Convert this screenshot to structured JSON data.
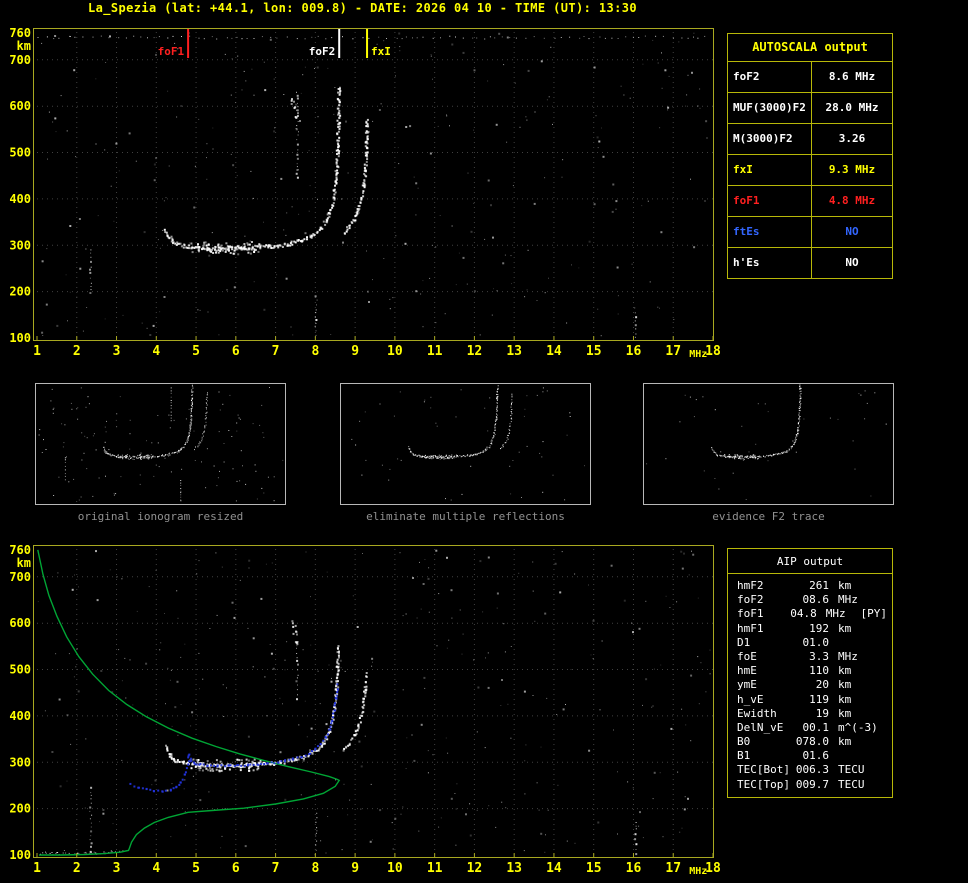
{
  "title": "La_Spezia (lat: +44.1, lon: 009.8) - DATE: 2026 04 10 - TIME (UT): 13:30",
  "colors": {
    "background": "#000000",
    "title": "#ffff00",
    "axis_label": "#ffff00",
    "plot_border": "#a8a820",
    "table_border": "#b8b808",
    "grid": "#404040",
    "trace": "#ffffff",
    "profile_green": "#00a535",
    "scaled_trace_blue": "#2233dd",
    "caption_gray": "#919191"
  },
  "autoscala_table": {
    "header": "AUTOSCALA output",
    "rows": [
      {
        "label": "foF2",
        "value": "8.6 MHz",
        "color": "#ffffff"
      },
      {
        "label": "MUF(3000)F2",
        "value": "28.0 MHz",
        "color": "#ffffff"
      },
      {
        "label": "M(3000)F2",
        "value": "3.26",
        "color": "#ffffff"
      },
      {
        "label": "fxI",
        "value": "9.3 MHz",
        "color": "#ffff00"
      },
      {
        "label": "foF1",
        "value": "4.8 MHz",
        "color": "#ff2020"
      },
      {
        "label": "ftEs",
        "value": "NO",
        "color": "#3366ff"
      },
      {
        "label": "h'Es",
        "value": "NO",
        "color": "#ffffff"
      }
    ]
  },
  "aip_table": {
    "header": "AIP output",
    "rows": [
      {
        "label": "hmF2",
        "value": "261",
        "unit": "km",
        "note": ""
      },
      {
        "label": "foF2",
        "value": "08.6",
        "unit": "MHz",
        "note": ""
      },
      {
        "label": "foF1",
        "value": "04.8",
        "unit": "MHz",
        "note": "[PY]"
      },
      {
        "label": "hmF1",
        "value": "192",
        "unit": "km",
        "note": ""
      },
      {
        "label": "D1",
        "value": "01.0",
        "unit": "",
        "note": ""
      },
      {
        "label": "foE",
        "value": "3.3",
        "unit": "MHz",
        "note": ""
      },
      {
        "label": "hmE",
        "value": "110",
        "unit": "km",
        "note": ""
      },
      {
        "label": "ymE",
        "value": "20",
        "unit": "km",
        "note": ""
      },
      {
        "label": "h_vE",
        "value": "119",
        "unit": "km",
        "note": ""
      },
      {
        "label": "Ewidth",
        "value": "19",
        "unit": "km",
        "note": ""
      },
      {
        "label": "DelN_vE",
        "value": "00.1",
        "unit": "m^(-3)",
        "note": ""
      },
      {
        "label": "B0",
        "value": "078.0",
        "unit": "km",
        "note": ""
      },
      {
        "label": "B1",
        "value": "01.6",
        "unit": "",
        "note": ""
      },
      {
        "label": "TEC[Bot]",
        "value": "006.3",
        "unit": "TECU",
        "note": ""
      },
      {
        "label": "TEC[Top]",
        "value": "009.7",
        "unit": "TECU",
        "note": ""
      }
    ]
  },
  "thumbnails": [
    {
      "caption": "original ionogram resized"
    },
    {
      "caption": "eliminate multiple reflections"
    },
    {
      "caption": "evidence F2 trace"
    }
  ],
  "chart_data": [
    {
      "type": "scatter",
      "name": "autoscaled ionogram (virtual height vs frequency)",
      "xlabel": "MHz",
      "ylabel": "km",
      "xlim": [
        1,
        18
      ],
      "ylim": [
        100,
        760
      ],
      "xticks": [
        1,
        2,
        3,
        4,
        5,
        6,
        7,
        8,
        9,
        10,
        11,
        12,
        13,
        14,
        15,
        16,
        17,
        18
      ],
      "yticks": [
        700,
        600,
        500,
        400,
        300,
        200,
        100
      ],
      "ytop_label": "760",
      "grid": true,
      "markers": [
        {
          "label": "foF1",
          "x": 4.8,
          "color": "#ff2020",
          "side": "left"
        },
        {
          "label": "foF2",
          "x": 8.6,
          "color": "#ffffff",
          "side": "left"
        },
        {
          "label": "fxI",
          "x": 9.3,
          "color": "#ffff00",
          "side": "right"
        }
      ],
      "f_trace": [
        [
          4.25,
          332
        ],
        [
          4.32,
          318
        ],
        [
          4.42,
          308
        ],
        [
          4.55,
          302
        ],
        [
          4.7,
          298
        ],
        [
          4.9,
          296
        ],
        [
          5.1,
          294
        ],
        [
          5.35,
          293
        ],
        [
          5.6,
          292
        ],
        [
          5.85,
          292
        ],
        [
          6.1,
          293
        ],
        [
          6.35,
          294
        ],
        [
          6.6,
          296
        ],
        [
          6.85,
          297
        ],
        [
          7.1,
          299
        ],
        [
          7.3,
          302
        ],
        [
          7.5,
          306
        ],
        [
          7.7,
          311
        ],
        [
          7.9,
          318
        ],
        [
          8.05,
          327
        ],
        [
          8.18,
          338
        ],
        [
          8.28,
          352
        ],
        [
          8.36,
          368
        ],
        [
          8.43,
          388
        ],
        [
          8.48,
          412
        ],
        [
          8.52,
          440
        ],
        [
          8.55,
          472
        ],
        [
          8.57,
          508
        ],
        [
          8.585,
          548
        ],
        [
          8.595,
          592
        ],
        [
          8.6,
          640
        ]
      ],
      "x_trace": [
        [
          8.72,
          328
        ],
        [
          8.85,
          340
        ],
        [
          8.98,
          356
        ],
        [
          9.08,
          376
        ],
        [
          9.16,
          400
        ],
        [
          9.22,
          428
        ],
        [
          9.26,
          458
        ],
        [
          9.285,
          492
        ],
        [
          9.3,
          530
        ],
        [
          9.31,
          572
        ]
      ],
      "echo_trace": [
        [
          7.45,
          610
        ],
        [
          7.5,
          592
        ],
        [
          7.55,
          574
        ]
      ],
      "stripes": [
        {
          "f": 2.35,
          "h1": 190,
          "h2": 290
        },
        {
          "f": 7.55,
          "h1": 445,
          "h2": 630
        },
        {
          "f": 8.02,
          "h1": 100,
          "h2": 190
        },
        {
          "f": 16.05,
          "h1": 100,
          "h2": 165
        }
      ]
    },
    {
      "type": "scatter",
      "name": "ionogram with AIP restored trace and electron density profile",
      "xlabel": "MHz",
      "ylabel": "km",
      "xlim": [
        1,
        18
      ],
      "ylim": [
        100,
        760
      ],
      "xticks": [
        1,
        2,
        3,
        4,
        5,
        6,
        7,
        8,
        9,
        10,
        11,
        12,
        13,
        14,
        15,
        16,
        17,
        18
      ],
      "yticks": [
        700,
        600,
        500,
        400,
        300,
        200,
        100
      ],
      "ytop_label": "760",
      "grid": true,
      "f_trace": [
        [
          4.25,
          332
        ],
        [
          4.32,
          318
        ],
        [
          4.42,
          308
        ],
        [
          4.55,
          302
        ],
        [
          4.7,
          298
        ],
        [
          4.9,
          296
        ],
        [
          5.1,
          294
        ],
        [
          5.35,
          293
        ],
        [
          5.6,
          292
        ],
        [
          5.85,
          292
        ],
        [
          6.1,
          293
        ],
        [
          6.35,
          294
        ],
        [
          6.6,
          296
        ],
        [
          6.85,
          297
        ],
        [
          7.1,
          299
        ],
        [
          7.3,
          302
        ],
        [
          7.5,
          306
        ],
        [
          7.7,
          311
        ],
        [
          7.9,
          318
        ],
        [
          8.05,
          327
        ],
        [
          8.18,
          338
        ],
        [
          8.28,
          352
        ],
        [
          8.36,
          368
        ],
        [
          8.43,
          388
        ],
        [
          8.48,
          412
        ],
        [
          8.52,
          440
        ],
        [
          8.55,
          472
        ],
        [
          8.57,
          508
        ],
        [
          8.585,
          548
        ]
      ],
      "x_trace": [
        [
          8.72,
          328
        ],
        [
          8.85,
          340
        ],
        [
          8.98,
          356
        ],
        [
          9.08,
          376
        ],
        [
          9.16,
          400
        ],
        [
          9.22,
          428
        ],
        [
          9.26,
          458
        ],
        [
          9.285,
          492
        ]
      ],
      "echo_trace": [
        [
          7.45,
          598
        ],
        [
          7.5,
          580
        ],
        [
          7.55,
          560
        ]
      ],
      "stripes": [
        {
          "f": 2.35,
          "h1": 100,
          "h2": 245
        },
        {
          "f": 7.55,
          "h1": 430,
          "h2": 560
        },
        {
          "f": 8.02,
          "h1": 100,
          "h2": 190
        },
        {
          "f": 16.05,
          "h1": 100,
          "h2": 170
        }
      ],
      "e_trace": [
        [
          1.1,
          104
        ],
        [
          1.5,
          103
        ],
        [
          2.0,
          103
        ],
        [
          2.5,
          104
        ],
        [
          2.9,
          106
        ],
        [
          3.15,
          109
        ]
      ],
      "scaled_trace_blue": [
        [
          3.35,
          252
        ],
        [
          3.55,
          246
        ],
        [
          3.75,
          241
        ],
        [
          3.95,
          238
        ],
        [
          4.15,
          237
        ],
        [
          4.35,
          240
        ],
        [
          4.5,
          246
        ],
        [
          4.62,
          256
        ],
        [
          4.72,
          272
        ],
        [
          4.79,
          296
        ],
        [
          4.83,
          316
        ],
        [
          4.88,
          303
        ],
        [
          4.95,
          298
        ],
        [
          5.1,
          295
        ],
        [
          5.3,
          293
        ],
        [
          5.55,
          292
        ],
        [
          5.8,
          292
        ],
        [
          6.05,
          293
        ],
        [
          6.3,
          294
        ],
        [
          6.55,
          296
        ],
        [
          6.8,
          298
        ],
        [
          7.05,
          300
        ],
        [
          7.25,
          303
        ],
        [
          7.45,
          307
        ],
        [
          7.65,
          312
        ],
        [
          7.85,
          319
        ],
        [
          8.0,
          328
        ],
        [
          8.15,
          339
        ],
        [
          8.27,
          353
        ],
        [
          8.36,
          370
        ],
        [
          8.43,
          390
        ],
        [
          8.48,
          413
        ],
        [
          8.52,
          437
        ],
        [
          8.55,
          458
        ],
        [
          8.57,
          468
        ]
      ],
      "profile_green": [
        [
          1.02,
          758
        ],
        [
          1.15,
          705
        ],
        [
          1.3,
          660
        ],
        [
          1.5,
          615
        ],
        [
          1.75,
          570
        ],
        [
          2.05,
          528
        ],
        [
          2.4,
          490
        ],
        [
          2.8,
          455
        ],
        [
          3.25,
          425
        ],
        [
          3.75,
          398
        ],
        [
          4.3,
          374
        ],
        [
          4.9,
          352
        ],
        [
          5.5,
          334
        ],
        [
          6.1,
          318
        ],
        [
          6.7,
          304
        ],
        [
          7.3,
          291
        ],
        [
          7.9,
          279
        ],
        [
          8.35,
          269
        ],
        [
          8.55,
          263
        ],
        [
          8.6,
          261
        ],
        [
          8.5,
          248
        ],
        [
          8.2,
          233
        ],
        [
          7.7,
          221
        ],
        [
          7.0,
          210
        ],
        [
          6.2,
          201
        ],
        [
          5.4,
          196
        ],
        [
          4.8,
          192
        ],
        [
          4.3,
          181
        ],
        [
          3.95,
          170
        ],
        [
          3.7,
          158
        ],
        [
          3.5,
          144
        ],
        [
          3.38,
          128
        ],
        [
          3.32,
          114
        ],
        [
          3.3,
          110
        ],
        [
          3.1,
          106
        ],
        [
          2.7,
          103
        ],
        [
          2.2,
          101
        ],
        [
          1.6,
          100
        ],
        [
          1.05,
          100
        ]
      ]
    }
  ]
}
